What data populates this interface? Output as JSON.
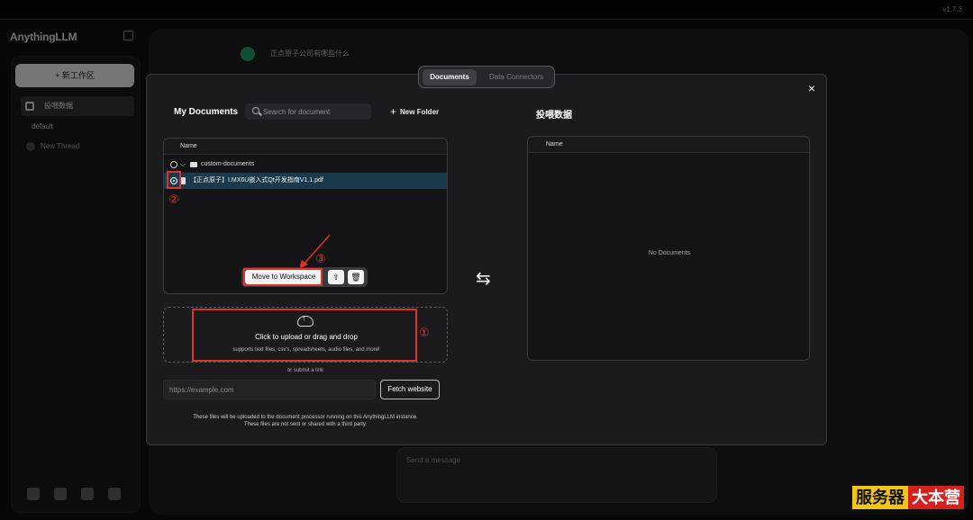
{
  "app": {
    "version": "v1.7.3",
    "brand": "AnythingLLM"
  },
  "sidebar": {
    "new_workspace": "+ 新工作区",
    "workspace": "投喂数据",
    "thread_default": "default",
    "new_thread": "New Thread"
  },
  "chat": {
    "message": "正点原子公司有哪些什么",
    "input_placeholder": "Send a message"
  },
  "tabs": [
    "Documents",
    "Data Connectors"
  ],
  "modal": {
    "close": "×",
    "my_documents": {
      "title": "My Documents",
      "search_placeholder": "Search for document",
      "new_folder": "New Folder",
      "header_name": "Name",
      "folder": "custom-documents",
      "file": "【正点原子】I.MX6U嵌入式Qt开发指南V1.1.pdf",
      "move_button": "Move to Workspace"
    },
    "upload": {
      "title": "Click to upload or drag and drop",
      "subtitle": "supports text files, csv's, spreadsheets, audio files, and more!",
      "or_submit": "or submit a link",
      "url_placeholder": "https://example.com",
      "fetch_button": "Fetch website",
      "notice_line1": "These files will be uploaded to the document processor running on this AnythingLLM instance.",
      "notice_line2": "These files are not sent or shared with a third party."
    },
    "workspace_docs": {
      "title": "投喂数据",
      "header_name": "Name",
      "empty": "No Documents"
    }
  },
  "annotations": [
    "①",
    "②",
    "③"
  ],
  "watermark": {
    "part1": "服务器",
    "part2": "大本营"
  },
  "colors": {
    "annotation": "#e0322b",
    "selected_row": "#193a4a"
  }
}
